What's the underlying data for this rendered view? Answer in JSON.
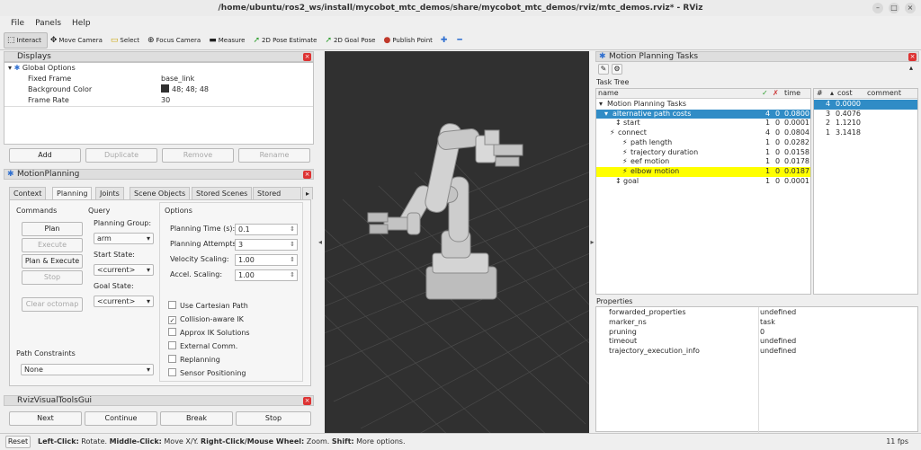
{
  "window": {
    "title": "/home/ubuntu/ros2_ws/install/mycobot_mtc_demos/share/mycobot_mtc_demos/rviz/mtc_demos.rviz* - RViz"
  },
  "menu": [
    "File",
    "Panels",
    "Help"
  ],
  "toolbar": [
    {
      "label": "Interact",
      "icon": "interact-icon"
    },
    {
      "label": "Move Camera",
      "icon": "move-camera-icon"
    },
    {
      "label": "Select",
      "icon": "select-icon"
    },
    {
      "label": "Focus Camera",
      "icon": "focus-camera-icon"
    },
    {
      "label": "Measure",
      "icon": "measure-icon"
    },
    {
      "label": "2D Pose Estimate",
      "icon": "pose-estimate-icon"
    },
    {
      "label": "2D Goal Pose",
      "icon": "goal-pose-icon"
    },
    {
      "label": "Publish Point",
      "icon": "publish-point-icon"
    }
  ],
  "displays": {
    "title": "Displays",
    "tree_header": "Global Options",
    "rows": [
      {
        "name": "Fixed Frame",
        "value": "base_link"
      },
      {
        "name": "Background Color",
        "value": "48; 48; 48"
      },
      {
        "name": "Frame Rate",
        "value": "30"
      }
    ],
    "buttons": [
      "Add",
      "Duplicate",
      "Remove",
      "Rename"
    ]
  },
  "motion_planning": {
    "title": "MotionPlanning",
    "tabs": [
      "Context",
      "Planning",
      "Joints",
      "Scene Objects",
      "Stored Scenes",
      "Stored Stat"
    ],
    "commands_label": "Commands",
    "commands": [
      "Plan",
      "Execute",
      "Plan & Execute",
      "Stop",
      "Clear octomap"
    ],
    "query_label": "Query",
    "planning_group_label": "Planning Group:",
    "planning_group": "arm",
    "start_state_label": "Start State:",
    "start_state": "<current>",
    "goal_state_label": "Goal State:",
    "goal_state": "<current>",
    "options_label": "Options",
    "options": [
      {
        "label": "Planning Time (s):",
        "value": "0.1"
      },
      {
        "label": "Planning Attempts:",
        "value": "3"
      },
      {
        "label": "Velocity Scaling:",
        "value": "1.00"
      },
      {
        "label": "Accel. Scaling:",
        "value": "1.00"
      }
    ],
    "checks": [
      {
        "label": "Use Cartesian Path",
        "checked": false
      },
      {
        "label": "Collision-aware IK",
        "checked": true
      },
      {
        "label": "Approx IK Solutions",
        "checked": false
      },
      {
        "label": "External Comm.",
        "checked": false
      },
      {
        "label": "Replanning",
        "checked": false
      },
      {
        "label": "Sensor Positioning",
        "checked": false
      }
    ],
    "path_constraints_label": "Path Constraints",
    "path_constraints": "None"
  },
  "visual_tools": {
    "title": "RvizVisualToolsGui",
    "buttons": [
      "Next",
      "Continue",
      "Break",
      "Stop"
    ]
  },
  "mtc": {
    "title": "Motion Planning Tasks",
    "task_tree_label": "Task Tree",
    "columns": [
      "name",
      "✓",
      "✗",
      "time"
    ],
    "rows": [
      {
        "name": "Motion Planning Tasks",
        "ok": "",
        "fail": "",
        "time": ""
      },
      {
        "name": "alternative path costs",
        "ok": "4",
        "fail": "0",
        "time": "0.0800"
      },
      {
        "name": "start",
        "ok": "1",
        "fail": "0",
        "time": "0.0001"
      },
      {
        "name": "connect",
        "ok": "4",
        "fail": "0",
        "time": "0.0804"
      },
      {
        "name": "path length",
        "ok": "1",
        "fail": "0",
        "time": "0.0282"
      },
      {
        "name": "trajectory duration",
        "ok": "1",
        "fail": "0",
        "time": "0.0158"
      },
      {
        "name": "eef motion",
        "ok": "1",
        "fail": "0",
        "time": "0.0178"
      },
      {
        "name": "elbow motion",
        "ok": "1",
        "fail": "0",
        "time": "0.0187"
      },
      {
        "name": "goal",
        "ok": "1",
        "fail": "0",
        "time": "0.0001"
      }
    ],
    "solution_columns": [
      "#",
      "cost",
      "comment"
    ],
    "solutions": [
      {
        "id": "4",
        "cost": "0.0000"
      },
      {
        "id": "3",
        "cost": "0.4076"
      },
      {
        "id": "2",
        "cost": "1.1210"
      },
      {
        "id": "1",
        "cost": "3.1418"
      }
    ],
    "properties_label": "Properties",
    "properties": [
      {
        "name": "forwarded_properties",
        "value": "undefined"
      },
      {
        "name": "marker_ns",
        "value": "task"
      },
      {
        "name": "pruning",
        "value": "0"
      },
      {
        "name": "timeout",
        "value": "undefined"
      },
      {
        "name": "trajectory_execution_info",
        "value": "undefined"
      }
    ]
  },
  "status": {
    "reset": "Reset",
    "left_click_key": "Left-Click:",
    "left_click_val": " Rotate.",
    "middle_click_key": "Middle-Click:",
    "middle_click_val": " Move X/Y.",
    "right_click_key": "Right-Click/Mouse Wheel:",
    "right_click_val": " Zoom.",
    "shift_key": "Shift:",
    "shift_val": " More options.",
    "fps": "11 fps"
  },
  "colors": {
    "selection": "#308cc6",
    "highlight": "#ffff00",
    "viewport_bg": "#303030",
    "close": "#dd3333"
  }
}
